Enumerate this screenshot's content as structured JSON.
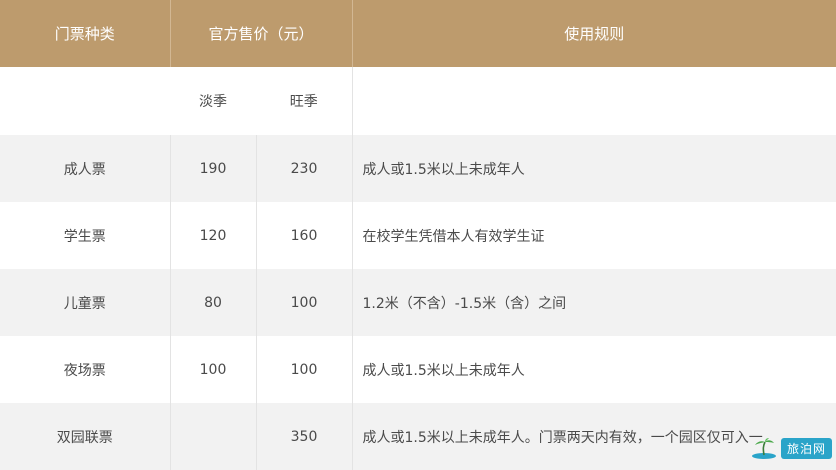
{
  "header": {
    "col_type": "门票种类",
    "col_price": "官方售价（元）",
    "col_rule": "使用规则"
  },
  "subheader": {
    "off_season": "淡季",
    "peak_season": "旺季"
  },
  "rows": [
    {
      "type": "成人票",
      "off": "190",
      "peak": "230",
      "rule": "成人或1.5米以上未成年人"
    },
    {
      "type": "学生票",
      "off": "120",
      "peak": "160",
      "rule": "在校学生凭借本人有效学生证"
    },
    {
      "type": "儿童票",
      "off": "80",
      "peak": "100",
      "rule": "1.2米（不含）-1.5米（含）之间"
    },
    {
      "type": "夜场票",
      "off": "100",
      "peak": "100",
      "rule": "成人或1.5米以上未成年人"
    },
    {
      "type": "双园联票",
      "off": "",
      "peak": "350",
      "rule": "成人或1.5米以上未成年人。门票两天内有效，一个园区仅可入一"
    }
  ],
  "watermark": {
    "text": "旅泊网"
  },
  "colors": {
    "header_bg": "#bd9b6d",
    "row_alt_bg": "#f2f2f2",
    "watermark_bg": "#2aa4c9"
  }
}
